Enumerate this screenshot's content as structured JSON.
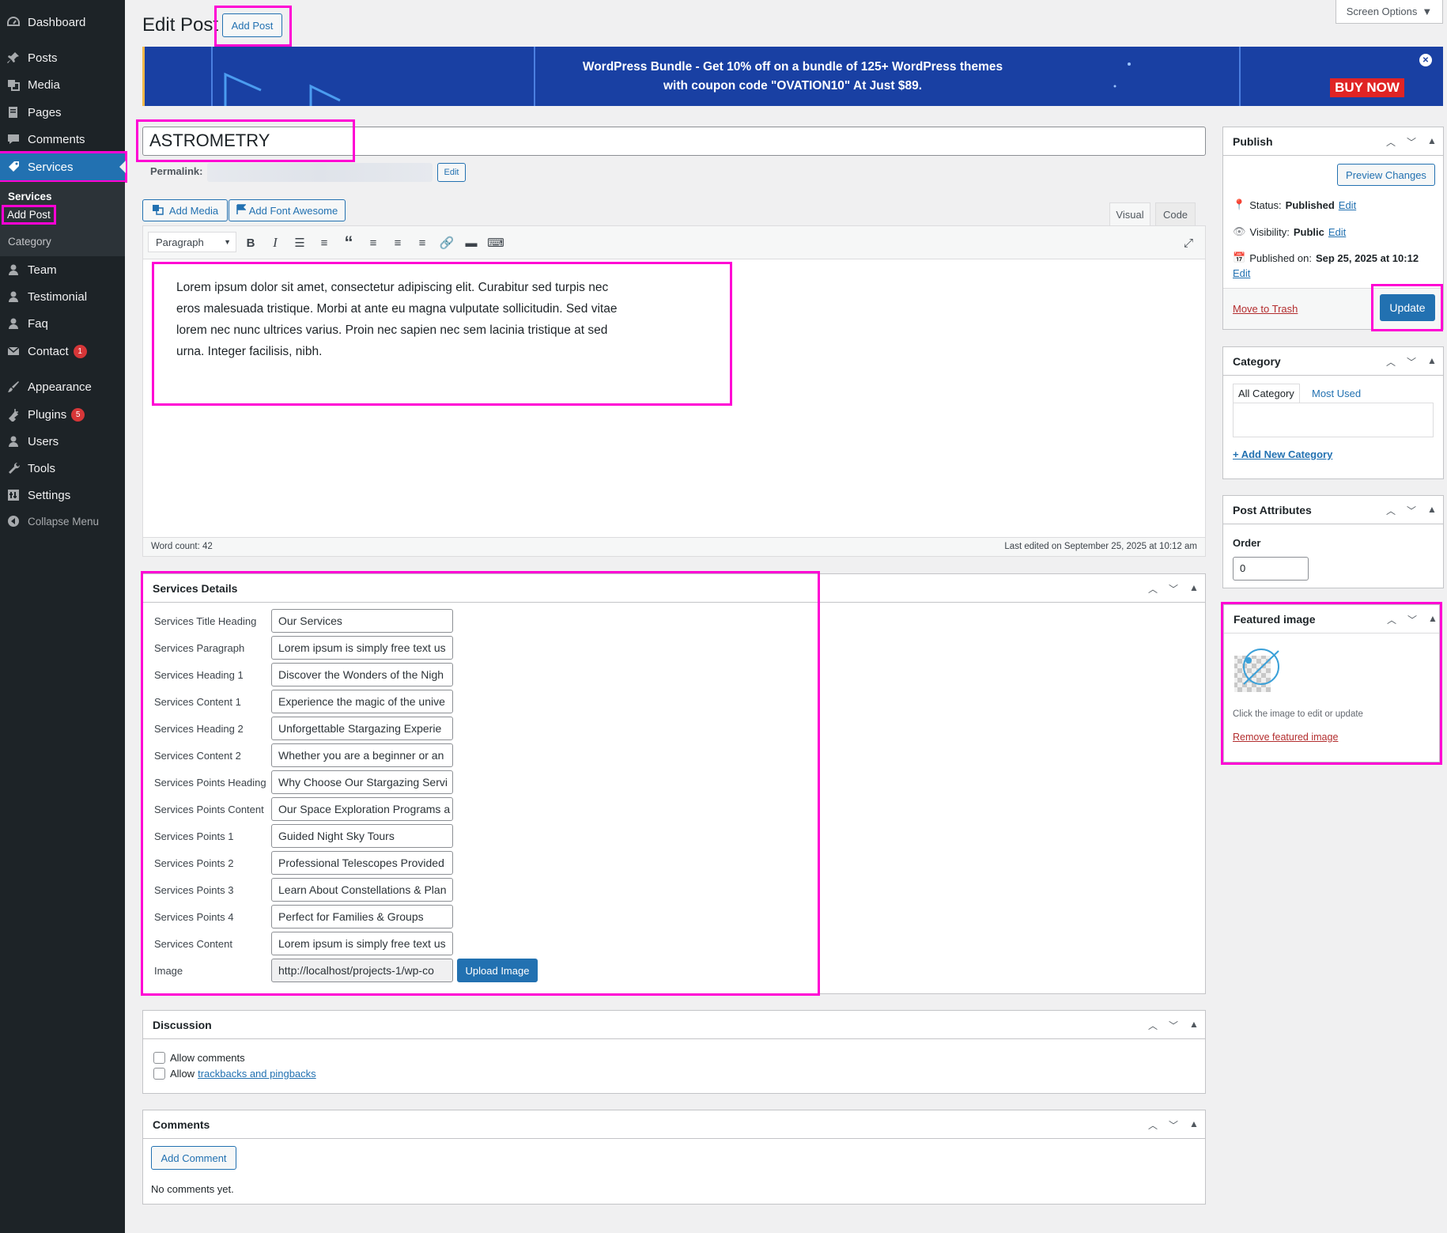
{
  "sidebar": {
    "items": [
      {
        "label": "Dashboard",
        "icon": "dashboard-icon"
      },
      {
        "label": "Posts",
        "icon": "pin-icon"
      },
      {
        "label": "Media",
        "icon": "media-icon"
      },
      {
        "label": "Pages",
        "icon": "pages-icon"
      },
      {
        "label": "Comments",
        "icon": "comments-icon"
      },
      {
        "label": "Services",
        "icon": "tag-icon"
      },
      {
        "label": "Team",
        "icon": "user-icon"
      },
      {
        "label": "Testimonial",
        "icon": "user-icon"
      },
      {
        "label": "Faq",
        "icon": "user-icon"
      },
      {
        "label": "Contact",
        "icon": "mail-icon",
        "badge": "1"
      },
      {
        "label": "Appearance",
        "icon": "brush-icon"
      },
      {
        "label": "Plugins",
        "icon": "plugin-icon",
        "badge": "5"
      },
      {
        "label": "Users",
        "icon": "users-icon"
      },
      {
        "label": "Tools",
        "icon": "wrench-icon"
      },
      {
        "label": "Settings",
        "icon": "settings-icon"
      },
      {
        "label": "Collapse Menu",
        "icon": "collapse-icon"
      }
    ],
    "submenu": {
      "title": "Services",
      "add_post": "Add Post",
      "category": "Category"
    }
  },
  "header": {
    "title": "Edit Post",
    "add_post": "Add Post",
    "screen_options": "Screen Options"
  },
  "banner": {
    "line1": "WordPress Bundle - Get 10% off on a bundle of 125+ WordPress themes",
    "line2": "with coupon code \"OVATION10\" At Just $89.",
    "buy_now": "BUY NOW",
    "close": "✕"
  },
  "post": {
    "title": "ASTROMETRY",
    "permalink_label": "Permalink:",
    "permalink_edit": "Edit"
  },
  "editor": {
    "add_media": "Add Media",
    "add_font_awesome": "Add Font Awesome",
    "tab_visual": "Visual",
    "tab_code": "Code",
    "format_select": "Paragraph",
    "content": "Lorem ipsum dolor sit amet, consectetur adipiscing elit. Curabitur sed turpis nec eros malesuada tristique. Morbi at ante eu magna vulputate sollicitudin. Sed vitae lorem nec nunc ultrices varius. Proin nec sapien nec sem lacinia tristique at sed urna. Integer facilisis, nibh.",
    "word_count": "Word count: 42",
    "last_edited": "Last edited on September 25, 2025 at 10:12 am"
  },
  "services_details": {
    "title": "Services Details",
    "fields": [
      {
        "label": "Services Title Heading",
        "value": "Our Services"
      },
      {
        "label": "Services Paragraph",
        "value": "Lorem ipsum is simply free text us"
      },
      {
        "label": "Services Heading 1",
        "value": "Discover the Wonders of the Nigh"
      },
      {
        "label": "Services Content 1",
        "value": "Experience the magic of the unive"
      },
      {
        "label": "Services Heading 2",
        "value": "Unforgettable Stargazing Experie"
      },
      {
        "label": "Services Content 2",
        "value": "Whether you are a beginner or an"
      },
      {
        "label": "Services Points Heading",
        "value": "Why Choose Our Stargazing Servi"
      },
      {
        "label": "Services Points Content",
        "value": "Our Space Exploration Programs a"
      },
      {
        "label": "Services Points 1",
        "value": "Guided Night Sky Tours"
      },
      {
        "label": "Services Points 2",
        "value": "Professional Telescopes Provided"
      },
      {
        "label": "Services Points 3",
        "value": "Learn About Constellations & Plan"
      },
      {
        "label": "Services Points 4",
        "value": "Perfect for Families & Groups"
      },
      {
        "label": "Services Content",
        "value": "Lorem ipsum is simply free text us"
      },
      {
        "label": "Image",
        "value": "http://localhost/projects-1/wp-co"
      }
    ],
    "upload_image": "Upload Image"
  },
  "discussion": {
    "title": "Discussion",
    "allow_comments": "Allow comments",
    "allow_prefix": "Allow",
    "trackbacks_link": "trackbacks and pingbacks"
  },
  "comments": {
    "title": "Comments",
    "add_comment": "Add Comment",
    "none": "No comments yet."
  },
  "publish": {
    "title": "Publish",
    "preview": "Preview Changes",
    "status_label": "Status:",
    "status_value": "Published",
    "visibility_label": "Visibility:",
    "visibility_value": "Public",
    "published_label": "Published on:",
    "published_value": "Sep 25, 2025 at 10:12",
    "edit": "Edit",
    "trash": "Move to Trash",
    "update": "Update"
  },
  "category": {
    "title": "Category",
    "tab_all": "All Category",
    "tab_most": "Most Used",
    "add_new": "+ Add New Category"
  },
  "post_attributes": {
    "title": "Post Attributes",
    "order_label": "Order",
    "order_value": "0"
  },
  "featured_image": {
    "title": "Featured image",
    "hint": "Click the image to edit or update",
    "remove": "Remove featured image"
  },
  "colors": {
    "accent": "#2271b1",
    "highlight": "#ff00d4",
    "sidebar": "#1d2327",
    "danger": "#d63638"
  }
}
